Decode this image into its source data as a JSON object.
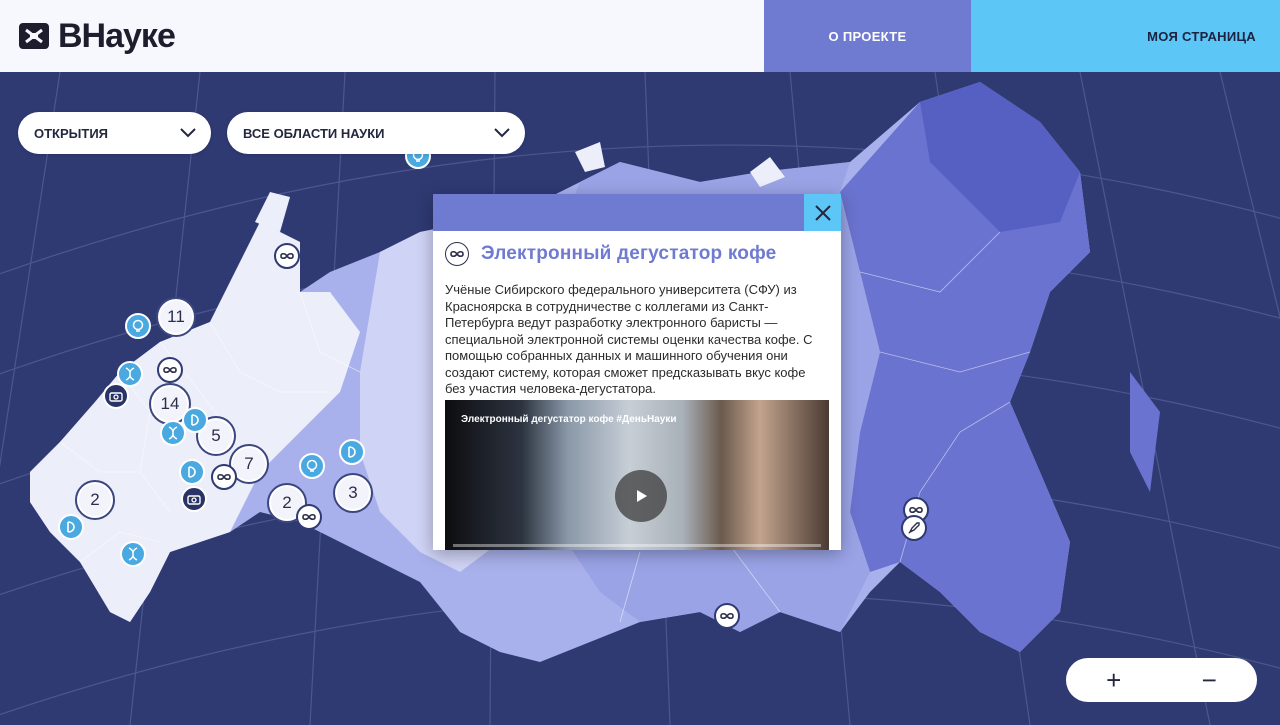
{
  "header": {
    "logo_text": "ВНауке",
    "nav_about": "О ПРОЕКТЕ",
    "nav_my_page": "МОЯ СТРАНИЦА"
  },
  "filters": {
    "type_value": "ОТКРЫТИЯ",
    "area_value": "ВСЕ ОБЛАСТИ НАУКИ"
  },
  "clusters": [
    "11",
    "14",
    "5",
    "7",
    "2",
    "2",
    "3"
  ],
  "popup": {
    "title": "Электронный дегустатор кофе",
    "description": "Учёные Сибирского федерального университета (СФУ) из Красноярска в сотрудничестве с коллегами из Санкт-Петербурга ведут разработку электронного баристы — специальной электронной системы оценки качества кофе. С помощью собранных данных и машинного обучения они создают систему, которая сможет предсказывать вкус кофе без участия человека-дегустатора.",
    "video_title": "Электронный дегустатор кофе #ДеньНауки",
    "category_icon": "infinity-icon"
  },
  "zoom": {
    "in": "+",
    "out": "−"
  },
  "colors": {
    "ocean": "#2f3a73",
    "accent_purple": "#6f7ad1",
    "accent_cyan": "#5cc6f7"
  }
}
